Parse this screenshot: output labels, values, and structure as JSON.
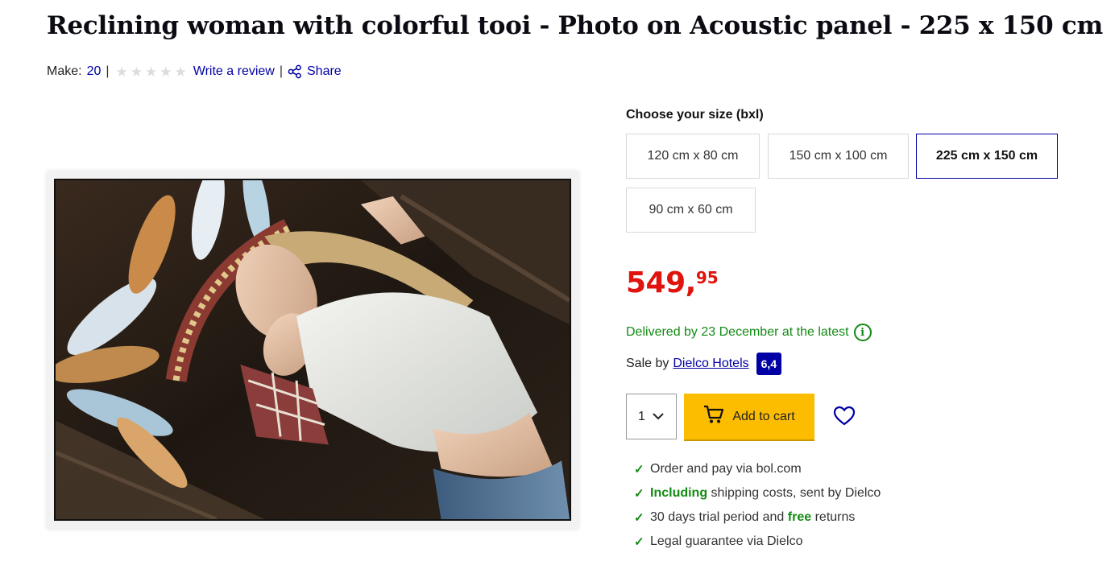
{
  "product": {
    "title": "Reclining woman with colorful tooi - Photo on Acoustic panel - 225 x 150 cm"
  },
  "meta": {
    "make_label": "Make:",
    "make_value": "20",
    "separator": "|",
    "rating_stars_filled": 0,
    "rating_stars_total": 5,
    "write_review": "Write a review",
    "share": "Share"
  },
  "size": {
    "label": "Choose your size (bxl)",
    "options": [
      {
        "label": "120 cm x 80 cm",
        "selected": false
      },
      {
        "label": "150 cm x 100 cm",
        "selected": false
      },
      {
        "label": "225 cm x 150 cm",
        "selected": true
      },
      {
        "label": "90 cm x 60 cm",
        "selected": false
      }
    ]
  },
  "price": {
    "whole": "549,",
    "cents": "95",
    "color": "#e0130d"
  },
  "delivery": {
    "text": "Delivered by 23 December at the latest",
    "icon": "info-icon"
  },
  "seller": {
    "prefix": "Sale by",
    "name": "Dielco Hotels",
    "score": "6,4"
  },
  "purchase": {
    "quantity": "1",
    "add_to_cart": "Add to cart",
    "cart_color": "#fcbc00"
  },
  "usps": {
    "item1": "Order and pay via bol.com",
    "item2_hl": "Including",
    "item2_rest": " shipping costs, sent by Dielco",
    "item3_pre": "30 days trial period and ",
    "item3_hl": "free",
    "item3_post": " returns",
    "item4": "Legal guarantee via Dielco"
  },
  "colors": {
    "link": "#0000a4",
    "success": "#138a13"
  }
}
